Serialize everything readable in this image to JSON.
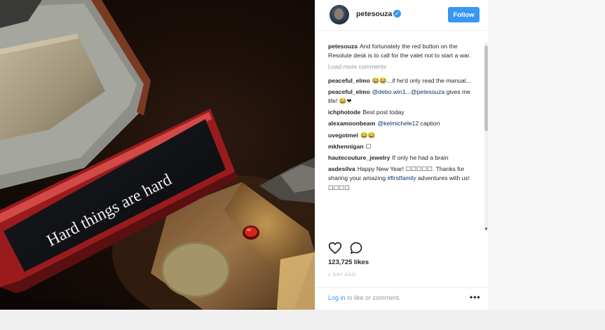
{
  "post": {
    "username": "petesouza",
    "verified_icon": "verified-badge-icon",
    "follow_label": "Follow",
    "photo_plaque_text": "Hard things are hard",
    "caption": {
      "user": "petesouza",
      "text": "And fortunately the red button on the Resolute desk is to call for the valet not to start a war."
    },
    "load_more": "Load more comments",
    "comments": [
      {
        "user": "peaceful_elmo",
        "text": "😂😂...if he'd only read the manual..."
      },
      {
        "user": "peaceful_elmo",
        "mention": "@debo.win1",
        "mention2": "@petesouza",
        "text_mid": "...",
        "text": "gives me life! 😂❤"
      },
      {
        "user": "ichphotode",
        "text": "Best post today"
      },
      {
        "user": "alexamoonbeam",
        "mention": "@kelmichele12",
        "text": "caption"
      },
      {
        "user": "uvegotmel",
        "text": "😂😂"
      },
      {
        "user": "mkhennigan",
        "text": "☐"
      },
      {
        "user": "hautecouture_jewelry",
        "text": "If only he had a brain"
      },
      {
        "user": "asdesilva",
        "text_pre": "Happy New Year! ☐☐☐☐☐. Thanks for sharing your amazing",
        "hashtag": "#firstfamily",
        "text": "adventures with us! ☐☐☐☐"
      }
    ],
    "likes": "123,725 likes",
    "time_ago": "1 DAY AGO",
    "footer": {
      "login_link": "Log in",
      "login_rest": "to like or comment.",
      "more_label": "•••"
    },
    "icons": {
      "like": "heart-icon",
      "comment": "comment-bubble-icon",
      "scroll_down": "scroll-down-arrow-icon"
    }
  }
}
